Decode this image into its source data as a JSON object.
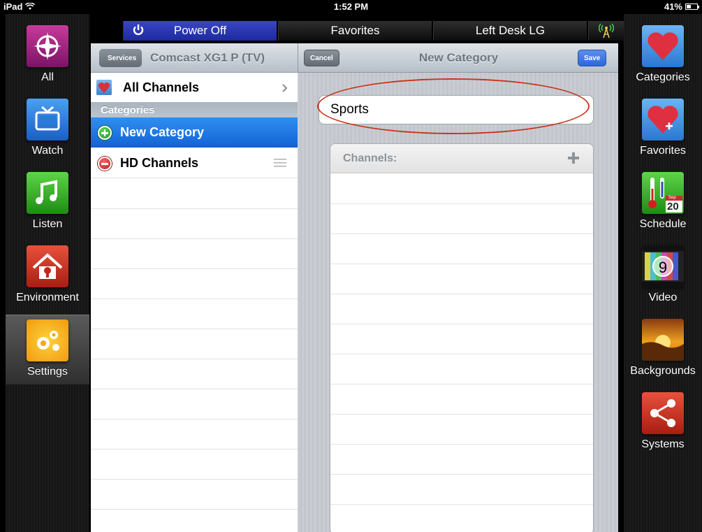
{
  "status_bar": {
    "device": "iPad",
    "time": "1:52 PM",
    "battery": "41%"
  },
  "top_bar": {
    "power_label": "Power Off",
    "favorites_label": "Favorites",
    "room_label": "Left Desk LG"
  },
  "left_nav": {
    "items": [
      {
        "label": "All"
      },
      {
        "label": "Watch"
      },
      {
        "label": "Listen"
      },
      {
        "label": "Environment"
      },
      {
        "label": "Settings"
      }
    ]
  },
  "right_nav": {
    "items": [
      {
        "label": "Categories"
      },
      {
        "label": "Favorites"
      },
      {
        "label": "Schedule",
        "badge_month": "Sep",
        "badge_day": "20"
      },
      {
        "label": "Video",
        "badge": "9"
      },
      {
        "label": "Backgrounds"
      },
      {
        "label": "Systems"
      }
    ]
  },
  "left_pane": {
    "back_label": "Services",
    "title": "Comcast XG1 P (TV)",
    "all_channels": "All Channels",
    "section": "Categories",
    "new_category": "New Category",
    "hd_channels": "HD Channels"
  },
  "right_pane": {
    "cancel_label": "Cancel",
    "title": "New Category",
    "save_label": "Save",
    "category_name": "Sports",
    "channels_header": "Channels:"
  },
  "colors": {
    "accent_blue": "#1f6fe0",
    "highlight_oval": "#c8371c",
    "power_blue": "#2a37b8"
  }
}
